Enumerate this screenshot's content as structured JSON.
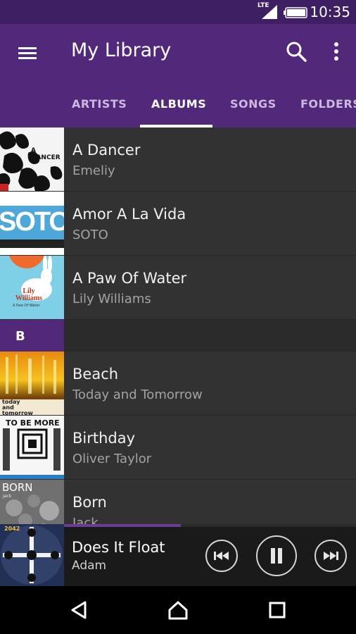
{
  "status_bar": {
    "time": "10:35",
    "network": "LTE"
  },
  "app_bar": {
    "title": "My Library",
    "menu_icon": "hamburger-menu-icon",
    "search_icon": "search-icon",
    "overflow_icon": "more-vert-icon"
  },
  "tabs": [
    {
      "label": "ARTISTS",
      "active": false
    },
    {
      "label": "ALBUMS",
      "active": true
    },
    {
      "label": "SONGS",
      "active": false
    },
    {
      "label": "FOLDERS",
      "active": false
    }
  ],
  "albums": [
    {
      "title": "A Dancer",
      "artist": "Emeliy",
      "art_text": "A DANCER"
    },
    {
      "title": "Amor A La Vida",
      "artist": "SOTO",
      "art_text": "SOTO"
    },
    {
      "title": "A Paw Of Water",
      "artist": "Lily Williams",
      "art_text": "Lily Williams",
      "art_subtext": "A Paw Of Water"
    }
  ],
  "section": {
    "letter": "B"
  },
  "albums_b": [
    {
      "title": "Beach",
      "artist": "Today and Tomorrow",
      "art_text": "today and tomorrow"
    },
    {
      "title": "Birthday",
      "artist": "Oliver Taylor",
      "art_text": "TO BE MORE"
    },
    {
      "title": "Born",
      "artist": "Jack",
      "art_text": "BORN",
      "art_subtext": "jack"
    }
  ],
  "now_playing": {
    "title": "Does It Float",
    "artist": "Adam",
    "progress": 0.4,
    "art_text": "2042"
  },
  "colors": {
    "primary": "#51287a",
    "status": "#3f1f63",
    "accent": "#6b3c98"
  }
}
